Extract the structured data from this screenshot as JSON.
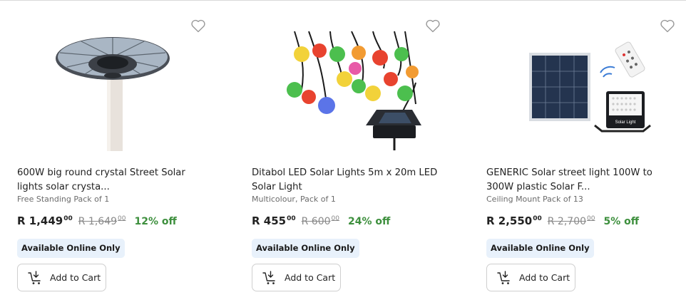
{
  "products": [
    {
      "title": "600W big round crystal Street Solar lights solar crysta...",
      "subtitle": "Free Standing Pack of 1",
      "price": "R 1,449",
      "price_cents": "00",
      "was_price": "R 1,649",
      "was_cents": "00",
      "discount": "12% off",
      "badge": "Available Online Only",
      "cart_label": "Add to Cart"
    },
    {
      "title": "Ditabol LED Solar Lights 5m x 20m LED Solar Light",
      "subtitle": "Multicolour, Pack of 1",
      "price": "R 455",
      "price_cents": "00",
      "was_price": "R 600",
      "was_cents": "00",
      "discount": "24% off",
      "badge": "Available Online Only",
      "cart_label": "Add to Cart"
    },
    {
      "title": "GENERIC Solar street light 100W to 300W plastic Solar F...",
      "subtitle": "Ceiling Mount Pack of 13",
      "price": "R 2,550",
      "price_cents": "00",
      "was_price": "R 2,700",
      "was_cents": "00",
      "discount": "5% off",
      "badge": "Available Online Only",
      "cart_label": "Add to Cart"
    }
  ],
  "product_image_text": {
    "solar_light_label": "Solar Light"
  },
  "colors": {
    "discount_green": "#3d8f3d",
    "badge_bg": "#e8f1fb"
  },
  "icons": [
    "heart-icon",
    "add-to-cart-icon"
  ]
}
